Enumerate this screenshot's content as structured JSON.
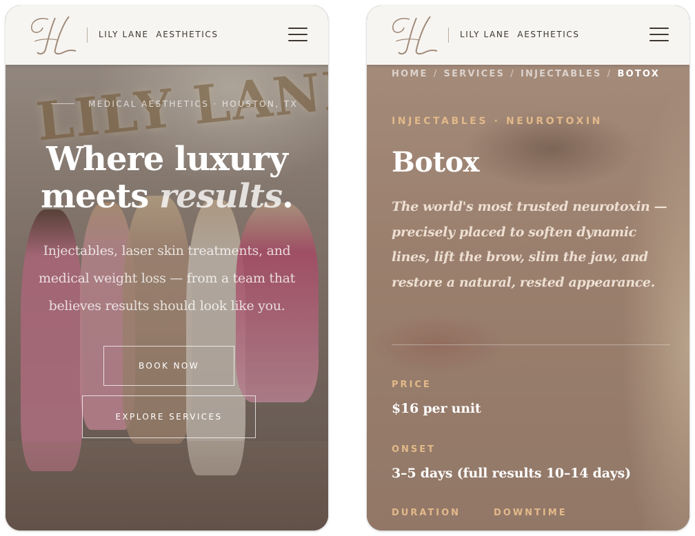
{
  "brand": {
    "name": "LILY LANE  AESTHETICS"
  },
  "hero": {
    "eyebrow": "MEDICAL AESTHETICS · HOUSTON, TX",
    "wall_sign": "LILY LANE",
    "title_line1": "Where luxury",
    "title_meets": "meets ",
    "title_emph": "results",
    "title_period": ".",
    "subtitle": "Injectables, laser skin treatments, and medical weight loss — from a team that believes results should look like you.",
    "book_label": "BOOK NOW",
    "explore_label": "EXPLORE SERVICES"
  },
  "detail": {
    "breadcrumb": [
      "HOME",
      "SERVICES",
      "INJECTABLES",
      "BOTOX"
    ],
    "eyebrow": "INJECTABLES · NEUROTOXIN",
    "title": "Botox",
    "lede": "The world's most trusted neurotoxin — precisely placed to soften dynamic lines, lift the brow, slim the jaw, and restore a natural, rested appearance.",
    "specs": {
      "price_label": "PRICE",
      "price_value": "$16 per unit",
      "onset_label": "ONSET",
      "onset_value": "3–5 days (full results 10–14 days)",
      "duration_label": "DURATION",
      "downtime_label": "DOWNTIME"
    }
  },
  "colors": {
    "accent_gold": "#e3b98a",
    "header_bg": "#f7f5f2",
    "text_dark": "#3d3631"
  },
  "icons": [
    "logo-monogram-icon",
    "hamburger-menu-icon"
  ]
}
